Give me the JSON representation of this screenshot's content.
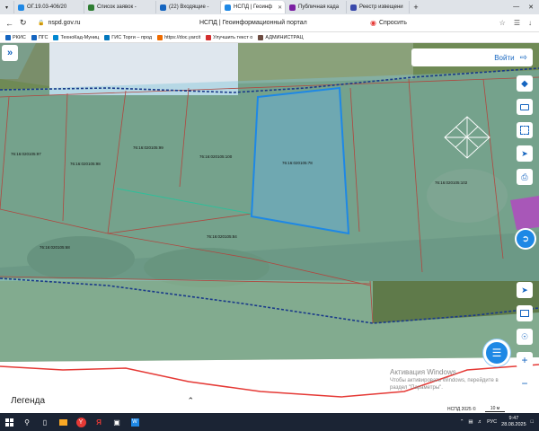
{
  "browser": {
    "tabs": [
      {
        "label": "ОГ.19.03-406/20",
        "color": "#1e88e5",
        "active": false
      },
      {
        "label": "Список заявок -",
        "color": "#2e7d32",
        "active": false
      },
      {
        "label": "(22) Входящие -",
        "color": "#1565c0",
        "active": false
      },
      {
        "label": "НСПД | Геоинф",
        "color": "#1e88e5",
        "active": true
      },
      {
        "label": "Публичная када",
        "color": "#7b1fa2",
        "active": false
      },
      {
        "label": "Реестр извещени",
        "color": "#3949ab",
        "active": false
      }
    ],
    "new_tab_label": "+",
    "address": "nspd.gov.ru",
    "page_title": "НСПД | Геоинформационный портал",
    "ask_label": "Спросить",
    "bookmarks": [
      {
        "label": "РКИС",
        "color": "#1565c0"
      },
      {
        "label": "ПГС",
        "color": "#1565c0"
      },
      {
        "label": "ТехноКад-Муниц",
        "color": "#0288d1"
      },
      {
        "label": "ГИС Торги – прод",
        "color": "#0277bd"
      },
      {
        "label": "https://doc.yarcit",
        "color": "#ef6c00"
      },
      {
        "label": "Улучшить текст о",
        "color": "#d32f2f"
      },
      {
        "label": "АДМИНИСТРАЦ",
        "color": "#6d4c41"
      }
    ]
  },
  "map": {
    "login_label": "Войти",
    "parcels": [
      {
        "id": "76:16:020105:97"
      },
      {
        "id": "76:16:020105:98"
      },
      {
        "id": "76:16:020105:99"
      },
      {
        "id": "76:16:020105:100"
      },
      {
        "id": "76:16:020105:78"
      },
      {
        "id": "76:16:020105:102"
      },
      {
        "id": "76:16:020105:68"
      },
      {
        "id": "76:16:020105:84"
      }
    ],
    "right_tools": [
      {
        "name": "layers-icon"
      },
      {
        "name": "card-icon"
      },
      {
        "name": "select-area-icon"
      },
      {
        "name": "share-icon"
      },
      {
        "name": "print-icon"
      }
    ],
    "lower_tools": [
      {
        "name": "navigate-icon"
      },
      {
        "name": "screen-icon"
      },
      {
        "name": "locate-icon"
      },
      {
        "name": "zoom-in-icon",
        "label": "+"
      },
      {
        "name": "zoom-out-icon",
        "label": "−"
      }
    ],
    "legend_label": "Легенда",
    "watermark_title": "Активация Windows",
    "watermark_sub1": "Чтобы активировать Windows, перейдите в",
    "watermark_sub2": "раздел \"Параметры\".",
    "attribution": "НСПД 2025 ©",
    "scale_label": "10 м",
    "colors": {
      "accent": "#1565c0",
      "parcel_fill": "#7fc4d8",
      "selected": "#1e88e5",
      "boundary_dashed": "#1a3a8a",
      "red_line": "#e53935"
    }
  },
  "taskbar": {
    "language": "РУС",
    "time": "9:47",
    "date": "28.08.2025"
  }
}
